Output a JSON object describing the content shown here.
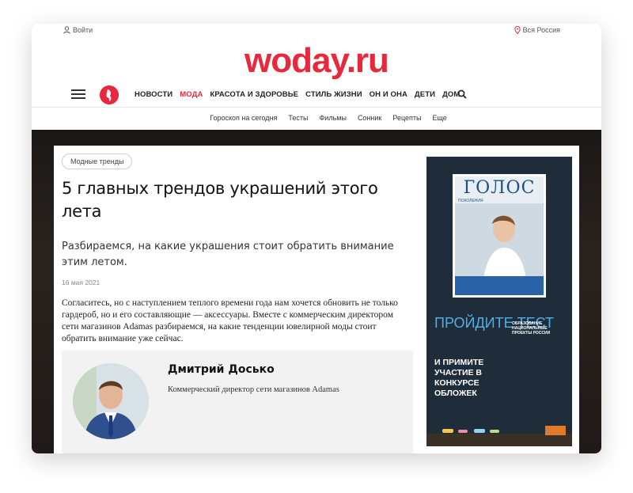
{
  "header": {
    "login_label": "Войти",
    "region_label": "Вся Россия",
    "logo_text": "woday.ru",
    "brand_color": "#e8283b"
  },
  "nav": {
    "items": [
      "НОВОСТИ",
      "МОДА",
      "КРАСОТА И ЗДОРОВЬЕ",
      "СТИЛЬ ЖИЗНИ",
      "ОН И ОНА",
      "ДЕТИ",
      "ДОМ"
    ],
    "active_item": "МОДА",
    "icons": [
      "menu-icon",
      "search-icon",
      "user-icon",
      "location-pin-icon"
    ]
  },
  "subnav": {
    "items": [
      "Гороскоп на сегодня",
      "Тесты",
      "Фильмы",
      "Сонник",
      "Рецепты",
      "Еще"
    ]
  },
  "article": {
    "tag": "Модные тренды",
    "title": "5 главных трендов украшений этого лета",
    "lead": "Разбираемся, на какие украшения стоит обратить внимание этим летом.",
    "date": "16 мая 2021",
    "body": "Согласитесь, но с наступлением теплого времени года нам хочется обновить не только гардероб, но и его составляющие — аксессуары. Вместе с коммерческим директором сети магазинов Adamas разбираемся, на какие тенденции ювелирной моды стоит обратить внимание уже сейчас.",
    "expert": {
      "name": "Дмитрий Досько",
      "role": "Коммерческий директор сети магазинов Adamas"
    }
  },
  "ad": {
    "magazine_title": "ГОЛОС",
    "magazine_subtitle": "ПОКОЛЕНИЯ",
    "headline": "ПРОЙДИТЕ ТЕСТ",
    "cta": "И ПРИМИТЕ УЧАСТИЕ В КОНКУРСЕ ОБЛОЖЕК",
    "partner": "ОБРАЗОВАНИЕ НАЦИОНАЛЬНЫЕ ПРОЕКТЫ РОССИИ"
  }
}
